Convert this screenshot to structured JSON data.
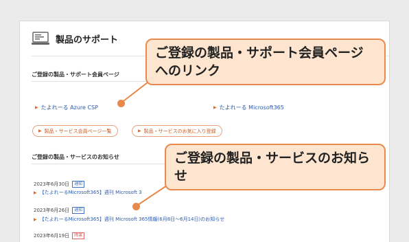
{
  "header": {
    "title": "製品のサポート",
    "icon": "monitor-icon"
  },
  "section1": {
    "heading": "ご登録の製品・サポート会員ページ",
    "links": [
      "たよれーる Azure CSP",
      "たよれーる Microsoft365"
    ],
    "pills": [
      "製品・サービス会員ページ一覧",
      "製品・サービスのお気に入り登録"
    ]
  },
  "section2": {
    "heading": "ご登録の製品・サービスのお知らせ",
    "news": [
      {
        "date": "2023年6月30日",
        "tag": "通知",
        "title": "【たよれーるMicrosoft365】週刊 Microsoft 3"
      },
      {
        "date": "2023年6月26日",
        "tag": "通知",
        "title": "【たよれーるMicrosoft365】週刊 Microsoft 365情報(6月8日〜6月14日)のお知らせ"
      },
      {
        "date": "2023年6月19日",
        "tag": "障害",
        "title": ""
      }
    ]
  },
  "callouts": {
    "top": "ご登録の製品・サポート会員ページへのリンク",
    "bottom": "ご登録の製品・サービスのお知らせ"
  },
  "colors": {
    "accent": "#e8884a",
    "callout_bg": "#fde5cf",
    "link": "#2b5bb0"
  }
}
